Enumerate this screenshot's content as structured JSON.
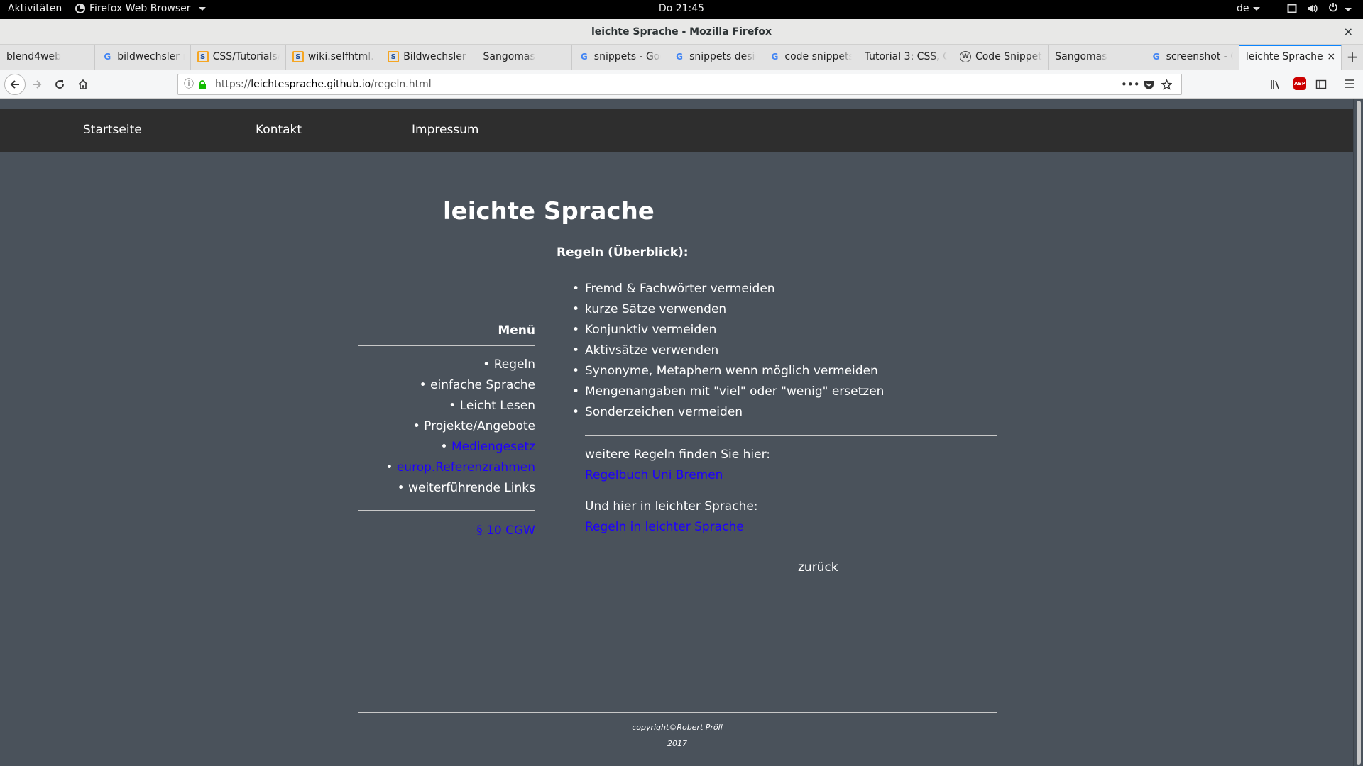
{
  "gnome": {
    "activities": "Aktivitäten",
    "app_name": "Firefox Web Browser",
    "clock": "Do 21:45",
    "lang": "de"
  },
  "window": {
    "title": "leichte Sprache - Mozilla Firefox",
    "close": "×"
  },
  "tabs": [
    {
      "label": "blend4web",
      "icon": "none"
    },
    {
      "label": "bildwechsler m",
      "icon": "google"
    },
    {
      "label": "CSS/Tutorials/",
      "icon": "selfhtml"
    },
    {
      "label": "wiki.selfhtml.o",
      "icon": "selfhtml"
    },
    {
      "label": "Bildwechsler m",
      "icon": "selfhtml"
    },
    {
      "label": "Sangomas",
      "icon": "none"
    },
    {
      "label": "snippets - Goo",
      "icon": "google"
    },
    {
      "label": "snippets desig",
      "icon": "google"
    },
    {
      "label": "code snippets",
      "icon": "google"
    },
    {
      "label": "Tutorial 3: CSS, C",
      "icon": "none"
    },
    {
      "label": "Code Snippets",
      "icon": "wordpress"
    },
    {
      "label": "Sangomas",
      "icon": "none"
    },
    {
      "label": "screenshot - G",
      "icon": "google"
    },
    {
      "label": "leichte Sprache",
      "icon": "none",
      "active": true
    }
  ],
  "tab_close": "×",
  "newtab": "+",
  "url": {
    "scheme": "https://",
    "host": "leichtesprache.github.io",
    "path": "/regeln.html",
    "more": "•••"
  },
  "site": {
    "nav": [
      "Startseite",
      "Kontakt",
      "Impressum"
    ],
    "title": "leichte Sprache",
    "menu_heading": "Menü",
    "menu": [
      {
        "label": "Regeln",
        "link": false
      },
      {
        "label": "einfache Sprache",
        "link": false
      },
      {
        "label": "Leicht Lesen",
        "link": false
      },
      {
        "label": "Projekte/Angebote",
        "link": false
      },
      {
        "label": "Mediengesetz",
        "link": true
      },
      {
        "label": "europ.Referenzrahmen",
        "link": true
      },
      {
        "label": "weiterführende Links",
        "link": false
      }
    ],
    "legal_link": "§ 10 CGW",
    "rules_heading": "Regeln (Überblick):",
    "rules": [
      "Fremd & Fachwörter vermeiden",
      "kurze Sätze verwenden",
      "Konjunktiv vermeiden",
      "Aktivsätze verwenden",
      "Synonyme, Metaphern wenn möglich vermeiden",
      "Mengenangaben mit \"viel\" oder \"wenig\" ersetzen",
      "Sonderzeichen vermeiden"
    ],
    "more_rules_text": "weitere Regeln finden Sie hier:",
    "more_rules_link": "Regelbuch Uni Bremen",
    "easy_text": "Und hier in leichter Sprache:",
    "easy_link": "Regeln in leichter Sprache",
    "back": "zurück",
    "copyright": "copyright©Robert Pröll",
    "year": "2017"
  },
  "colors": {
    "page_bg": "#4a525b",
    "nav_bg": "#2e2e2e",
    "link": "#1e00ff",
    "tab_active_accent": "#0a84ff"
  }
}
